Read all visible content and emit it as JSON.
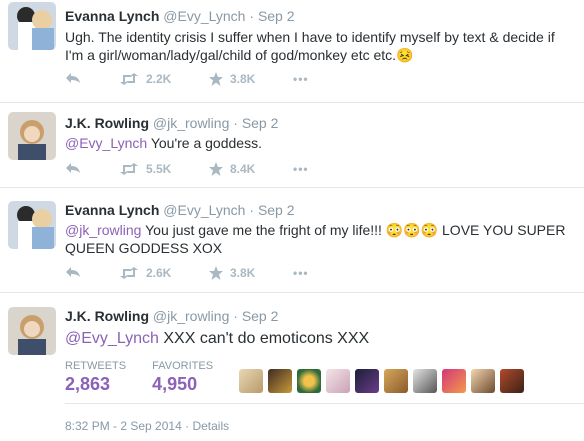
{
  "tweets": [
    {
      "name": "Evanna Lynch",
      "handle": "@Evy_Lynch",
      "date": "Sep 2",
      "text": "Ugh. The identity crisis I suffer when I have to identify myself by text & decide if I'm a girl/woman/lady/gal/child of god/monkey etc etc.",
      "emoji": "😣",
      "retweets": "2.2K",
      "favorites": "3.8K"
    },
    {
      "name": "J.K. Rowling",
      "handle": "@jk_rowling",
      "date": "Sep 2",
      "mention": "@Evy_Lynch",
      "text": " You're a goddess.",
      "retweets": "5.5K",
      "favorites": "8.4K"
    },
    {
      "name": "Evanna Lynch",
      "handle": "@Evy_Lynch",
      "date": "Sep 2",
      "mention": "@jk_rowling",
      "text_a": " You just gave me the fright of my life!!! ",
      "emoji": "😳😳😳",
      "text_b": " LOVE YOU SUPER QUEEN GODDESS XOX",
      "retweets": "2.6K",
      "favorites": "3.8K"
    },
    {
      "name": "J.K. Rowling",
      "handle": "@jk_rowling",
      "date": "Sep 2",
      "mention": "@Evy_Lynch",
      "text": " XXX can't do emoticons XXX",
      "retweets_label": "RETWEETS",
      "retweets": "2,863",
      "favorites_label": "FAVORITES",
      "favorites": "4,950",
      "timestamp": "8:32 PM - 2 Sep 2014",
      "details": "Details"
    }
  ],
  "separator": "·",
  "more_glyph": "•••",
  "colors": {
    "accent": "#8a62b7",
    "muted": "#8899a6",
    "icon": "#aab8c2",
    "text": "#292f33"
  }
}
